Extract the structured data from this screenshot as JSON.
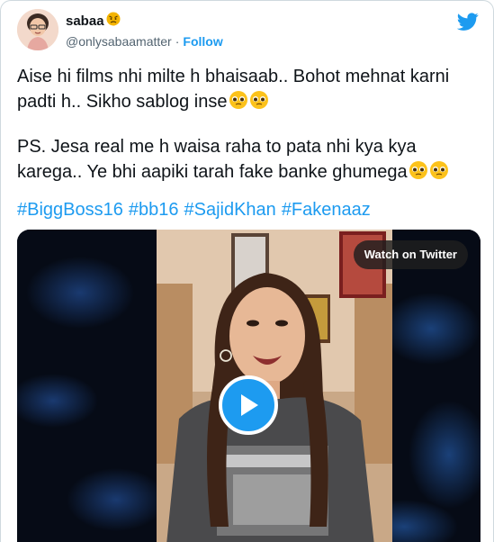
{
  "tweet": {
    "author": {
      "display_name": "sabaa",
      "name_emoji": "angry-face-emoji",
      "handle": "@onlysabaamatter",
      "separator": "·",
      "follow_label": "Follow",
      "avatar": "bitmoji-avatar"
    },
    "brand_icon": "twitter-bird-icon",
    "paragraphs": [
      {
        "text": "Aise hi films nhi milte h bhaisaab.. Bohot mehnat karni padti h.. Sikho sablog inse",
        "emojis": [
          "pleading-face-emoji",
          "pleading-face-emoji"
        ]
      },
      {
        "text": "PS.  Jesa real me h waisa raha to pata nhi kya kya karega.. Ye bhi aapiki tarah fake banke ghumega",
        "emojis": [
          "pleading-face-emoji",
          "pleading-face-emoji"
        ]
      }
    ],
    "hashtags": [
      "#BiggBoss16",
      "#bb16",
      "#SajidKhan",
      "#Fakenaaz"
    ],
    "media": {
      "type": "video",
      "watch_label": "Watch on Twitter",
      "play_icon": "play-icon"
    }
  },
  "colors": {
    "link": "#1d9bf0",
    "text": "#0f1419",
    "secondary": "#536471",
    "border": "#cfd9de"
  }
}
